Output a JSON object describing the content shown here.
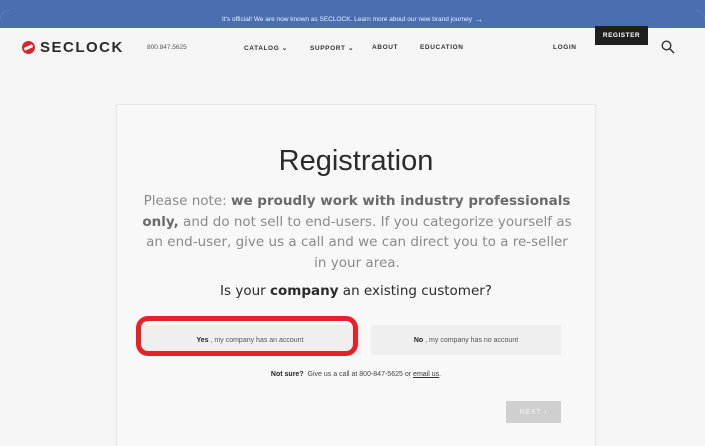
{
  "announcement": {
    "text": "It's official! We are now known as SECLOCK. Learn more about our new brand journey",
    "arrow": "→"
  },
  "header": {
    "logo": "SECLOCK",
    "phone": "800.847.5625",
    "menu": [
      "CATALOG ⌄",
      "SUPPORT ⌄",
      "ABOUT",
      "EDUCATION"
    ],
    "login": "LOGIN",
    "register": "REGISTER"
  },
  "registration": {
    "title": "Registration",
    "note_prefix": "Please note: ",
    "note_bold": "we proudly work with industry professionals only,",
    "note_rest": " and do not sell to end-users. If you categorize yourself as an end-user, give us a call and we can direct you to a re-seller in your area.",
    "question_prefix": "Is your ",
    "question_bold": "company",
    "question_suffix": " an existing customer?",
    "yes_bold": "Yes",
    "yes_rest": ", my company has an account",
    "no_bold": "No",
    "no_rest": ", my company has no account",
    "notsure_bold": "Not sure?",
    "notsure_rest": " Give us a call at 800-847-5625 or",
    "notsure_link": "email us",
    "notsure_end": ".",
    "next": "NEXT ›"
  },
  "colors": {
    "accent": "#4a6fb0",
    "brand_red": "#d9262e",
    "highlight": "#e8202a"
  }
}
